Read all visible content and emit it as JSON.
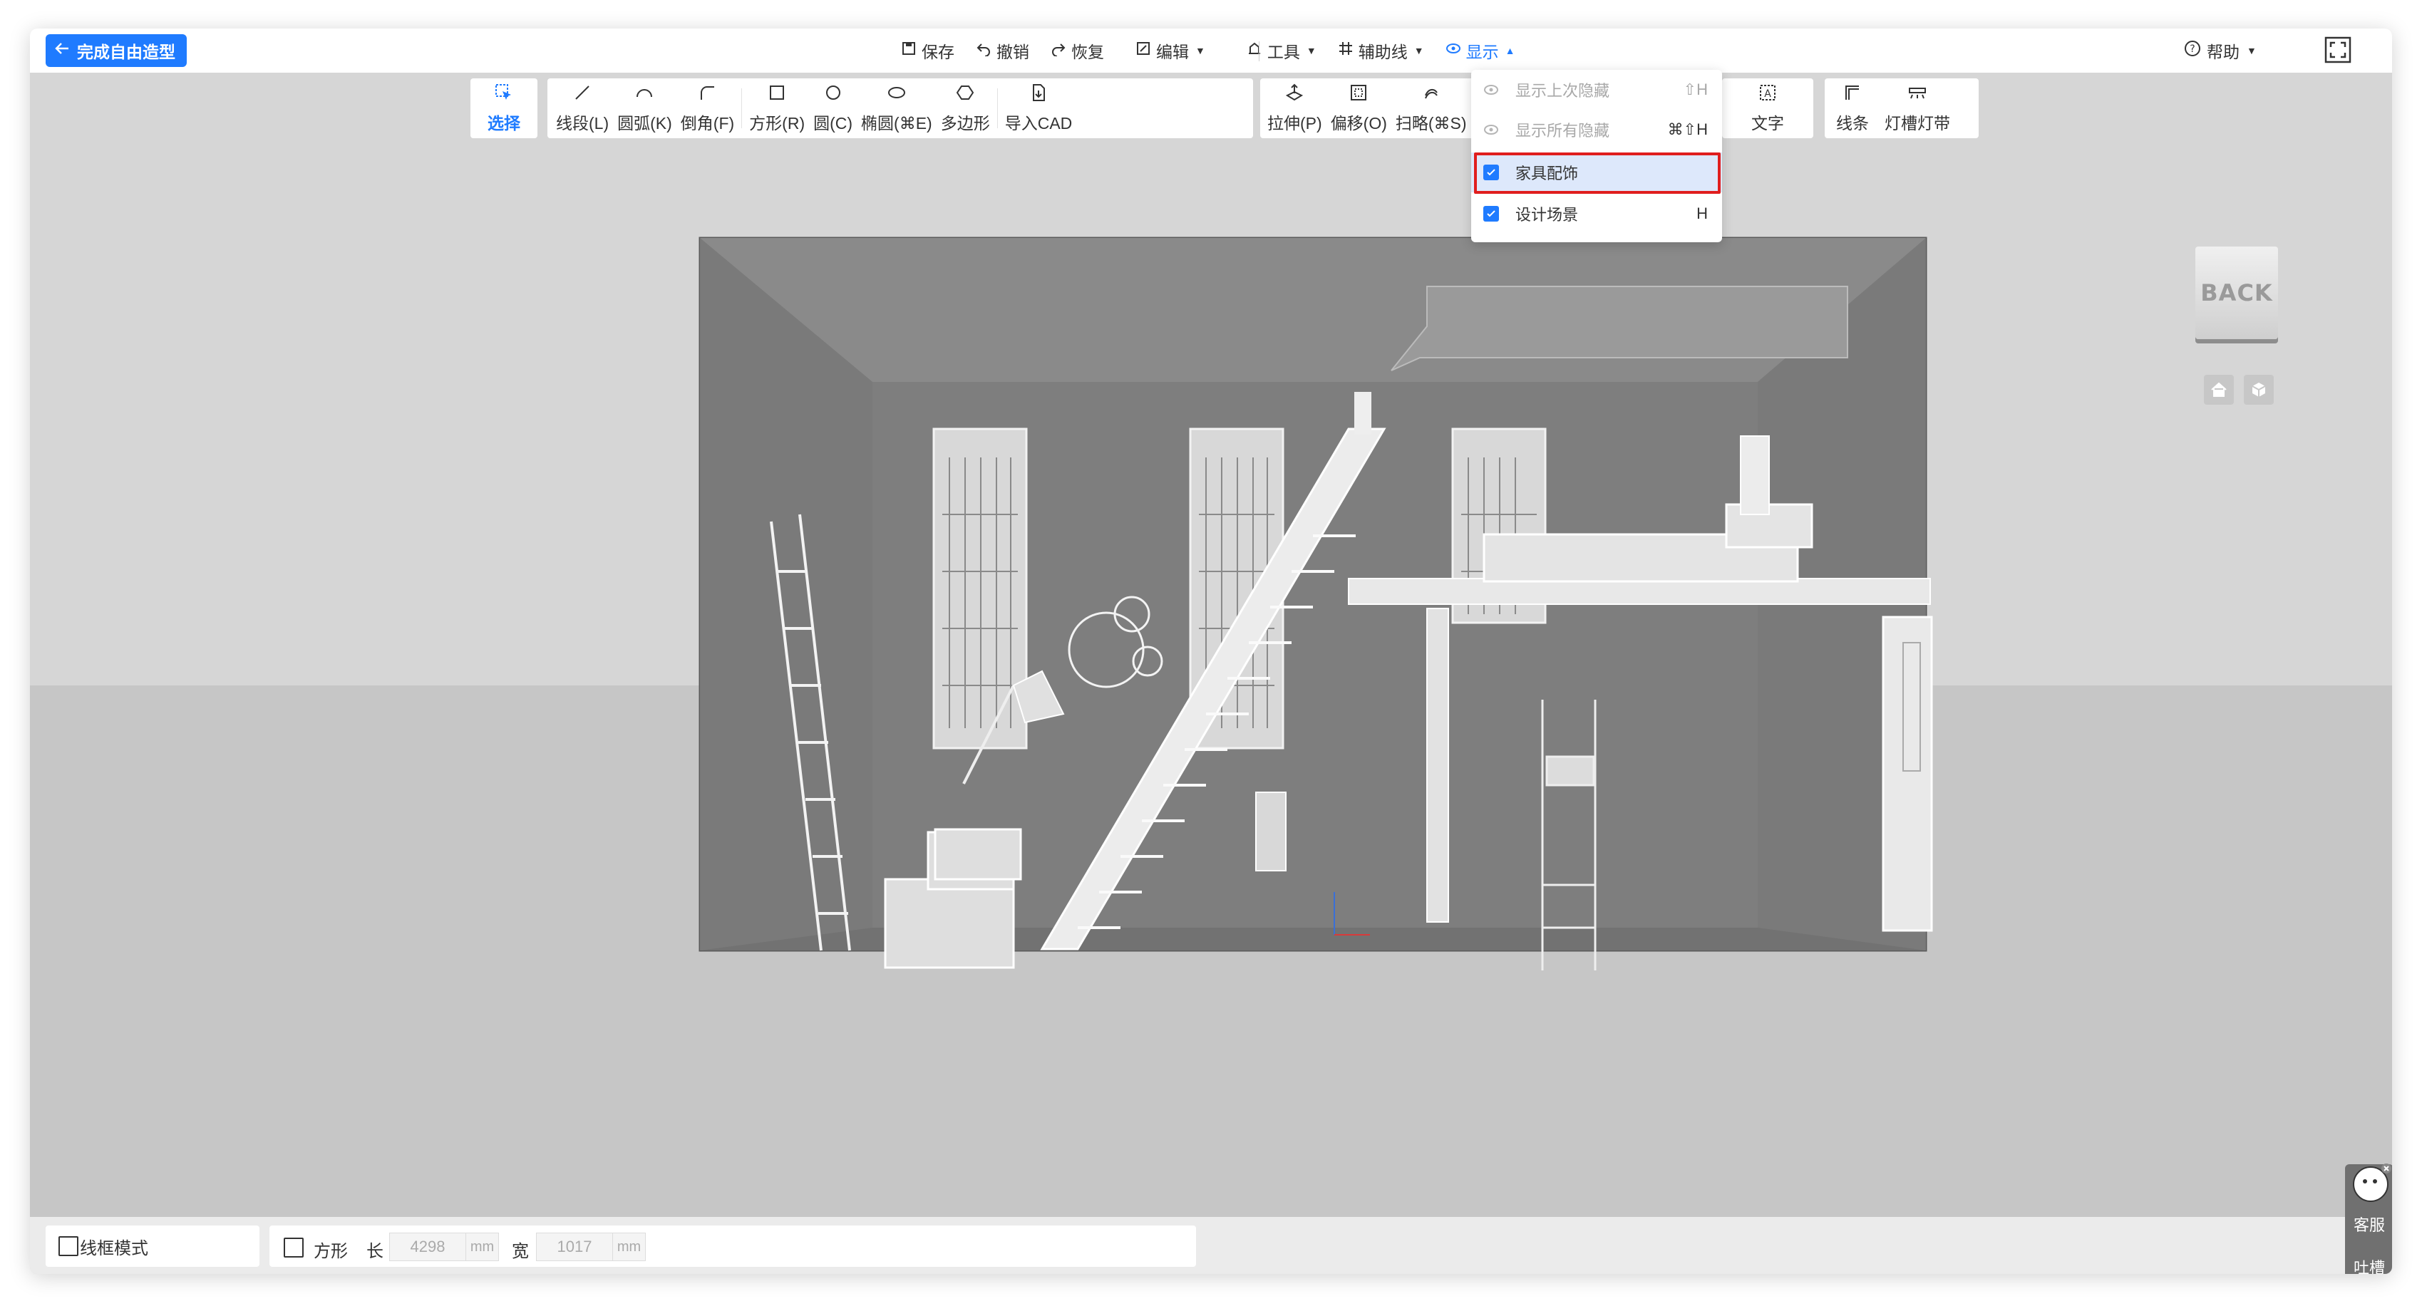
{
  "topbar": {
    "done_label": "完成自由造型",
    "save": "保存",
    "undo": "撤销",
    "redo": "恢复",
    "edit": "编辑",
    "tools": "工具",
    "guides": "辅助线",
    "display": "显示",
    "help": "帮助"
  },
  "toolbar": {
    "select": "选择",
    "line": "线段(L)",
    "arc": "圆弧(K)",
    "fillet": "倒角(F)",
    "rect": "方形(R)",
    "circle": "圆(C)",
    "ellipse": "椭圆(⌘E)",
    "polygon": "多边形",
    "import_cad": "导入CAD",
    "extrude": "拉伸(P)",
    "offset": "偏移(O)",
    "sweep": "扫略(⌘S)",
    "text": "文字",
    "lines": "线条",
    "light_strip": "灯槽灯带"
  },
  "display_menu": {
    "items": [
      {
        "label": "显示上次隐藏",
        "shortcut": "⇧H",
        "enabled": false,
        "checked": null
      },
      {
        "label": "显示所有隐藏",
        "shortcut": "⌘⇧H",
        "enabled": false,
        "checked": null
      },
      {
        "label": "家具配饰",
        "shortcut": "",
        "enabled": true,
        "checked": true
      },
      {
        "label": "设计场景",
        "shortcut": "H",
        "enabled": true,
        "checked": true
      }
    ]
  },
  "viewport": {
    "back_label": "BACK"
  },
  "bottombar": {
    "wireframe_label": "线框模式",
    "shape_label": "方形",
    "length_label": "长",
    "length_value": "4298",
    "width_label": "宽",
    "width_value": "1017",
    "unit": "mm"
  },
  "support": {
    "service": "客服",
    "feedback": "吐槽"
  },
  "colors": {
    "accent": "#1f7bff",
    "highlight_box": "#e01e1e",
    "scene_wall": "#7d7d7d"
  }
}
